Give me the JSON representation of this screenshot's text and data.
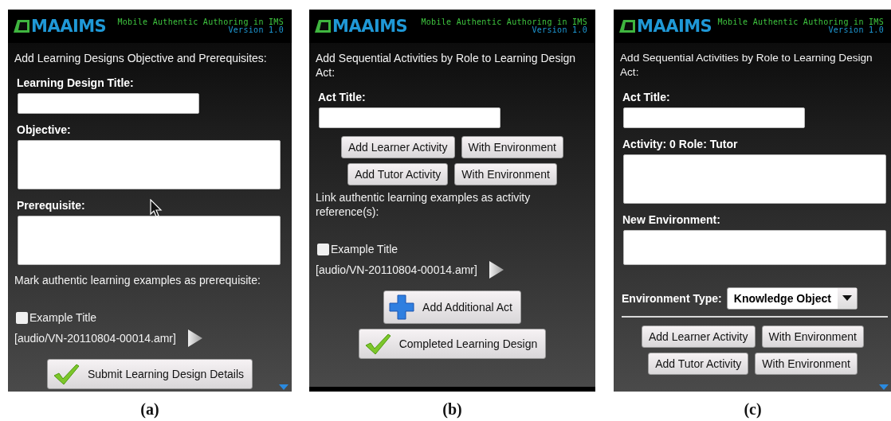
{
  "panels": [
    {
      "caption": "(a)",
      "header": {
        "logo": "MAAIMS",
        "tagline": "Mobile Authentic Authoring in IMS",
        "version": "Version 1.0"
      },
      "cursor": true,
      "more_below": true,
      "bottom_bar": false,
      "items": [
        {
          "kind": "text",
          "text": "Add Learning Designs Objective and Prerequisites:"
        },
        {
          "kind": "label",
          "text": "Learning Design Title:"
        },
        {
          "kind": "input"
        },
        {
          "kind": "label",
          "text": "Objective:"
        },
        {
          "kind": "textarea"
        },
        {
          "kind": "label",
          "text": "Prerequisite:"
        },
        {
          "kind": "textarea"
        },
        {
          "kind": "text",
          "text": "Mark authentic learning examples as prerequisite:"
        },
        {
          "kind": "checkbox",
          "label": "Example Title",
          "checked": false
        },
        {
          "kind": "audio",
          "text": "[audio/VN-20110804-00014.amr]"
        },
        {
          "kind": "check_action",
          "label": "Submit Learning Design Details"
        }
      ]
    },
    {
      "caption": "(b)",
      "header": {
        "logo": "MAAIMS",
        "tagline": "Mobile Authentic Authoring in IMS",
        "version": "Version 1.0"
      },
      "cursor": false,
      "more_below": false,
      "bottom_bar": true,
      "items": [
        {
          "kind": "text",
          "text": "Add Sequential Activities by Role to Learning Design Act:"
        },
        {
          "kind": "label",
          "text": "Act Title:"
        },
        {
          "kind": "input"
        },
        {
          "kind": "button_row",
          "buttons": [
            "Add Learner Activity",
            "With Environment"
          ]
        },
        {
          "kind": "button_row",
          "buttons": [
            "Add Tutor Activity",
            "With Environment"
          ]
        },
        {
          "kind": "text",
          "text": "Link authentic learning examples as activity reference(s):"
        },
        {
          "kind": "checkbox",
          "label": "Example Title",
          "checked": false
        },
        {
          "kind": "audio",
          "text": "[audio/VN-20110804-00014.amr]"
        },
        {
          "kind": "plus_action",
          "label": "Add Additional Act"
        },
        {
          "kind": "check_action",
          "label": "Completed Learning Design"
        }
      ]
    },
    {
      "caption": "(c)",
      "header": {
        "logo": "MAAIMS",
        "tagline": "Mobile Authentic Authoring in IMS",
        "version": "Version 1.0"
      },
      "cursor": false,
      "more_below": true,
      "bottom_bar": false,
      "items": [
        {
          "kind": "text",
          "text": "Add Sequential Activities by Role to Learning Design Act:"
        },
        {
          "kind": "label",
          "text": "Act Title:"
        },
        {
          "kind": "input"
        },
        {
          "kind": "label",
          "text": "Activity: 0 Role: Tutor"
        },
        {
          "kind": "textarea"
        },
        {
          "kind": "label",
          "text": "New Environment:"
        },
        {
          "kind": "textarea",
          "short": true
        },
        {
          "kind": "select",
          "label": "Environment Type:",
          "value": "Knowledge Object"
        },
        {
          "kind": "divider"
        },
        {
          "kind": "button_row",
          "buttons": [
            "Add Learner Activity",
            "With Environment"
          ]
        },
        {
          "kind": "button_row",
          "buttons": [
            "Add Tutor Activity",
            "With Environment"
          ]
        }
      ]
    }
  ]
}
